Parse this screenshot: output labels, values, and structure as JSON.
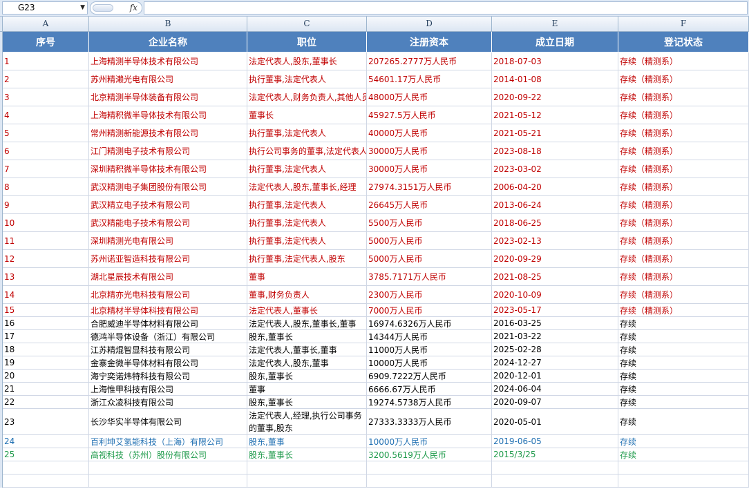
{
  "namebox": {
    "value": "G23"
  },
  "formula_bar": {
    "fx_label": "fx",
    "value": ""
  },
  "columns": [
    "A",
    "B",
    "C",
    "D",
    "E",
    "F"
  ],
  "headers": [
    "序号",
    "企业名称",
    "职位",
    "注册资本",
    "成立日期",
    "登记状态"
  ],
  "rows": [
    {
      "cells": [
        "1",
        "上海精测半导体技术有限公司",
        "法定代表人,股东,董事长",
        "207265.2777万人民币",
        "2018-07-03",
        "存续（精测系）"
      ],
      "color": "#c00000"
    },
    {
      "cells": [
        "2",
        "苏州精濑光电有限公司",
        "执行董事,法定代表人",
        "54601.17万人民币",
        "2014-01-08",
        "存续（精测系）"
      ],
      "color": "#c00000"
    },
    {
      "cells": [
        "3",
        "北京精测半导体装备有限公司",
        "法定代表人,财务负责人,其他人员",
        "48000万人民币",
        "2020-09-22",
        "存续（精测系）"
      ],
      "color": "#c00000"
    },
    {
      "cells": [
        "4",
        "上海精积微半导体技术有限公司",
        "董事长",
        "45927.5万人民币",
        "2021-05-12",
        "存续（精测系）"
      ],
      "color": "#c00000"
    },
    {
      "cells": [
        "5",
        "常州精测新能源技术有限公司",
        "执行董事,法定代表人",
        "40000万人民币",
        "2021-05-21",
        "存续（精测系）"
      ],
      "color": "#c00000"
    },
    {
      "cells": [
        "6",
        "江门精测电子技术有限公司",
        "执行公司事务的董事,法定代表人",
        "30000万人民币",
        "2023-08-18",
        "存续（精测系）"
      ],
      "color": "#c00000"
    },
    {
      "cells": [
        "7",
        "深圳精积微半导体技术有限公司",
        "执行董事,法定代表人",
        "30000万人民币",
        "2023-03-02",
        "存续（精测系）"
      ],
      "color": "#c00000"
    },
    {
      "cells": [
        "8",
        "武汉精测电子集团股份有限公司",
        "法定代表人,股东,董事长,经理",
        "27974.3151万人民币",
        "2006-04-20",
        "存续（精测系）"
      ],
      "color": "#c00000"
    },
    {
      "cells": [
        "9",
        "武汉精立电子技术有限公司",
        "执行董事,法定代表人",
        "26645万人民币",
        "2013-06-24",
        "存续（精测系）"
      ],
      "color": "#c00000"
    },
    {
      "cells": [
        "10",
        "武汉精能电子技术有限公司",
        "执行董事,法定代表人",
        "5500万人民币",
        "2018-06-25",
        "存续（精测系）"
      ],
      "color": "#c00000"
    },
    {
      "cells": [
        "11",
        "深圳精测光电有限公司",
        "执行董事,法定代表人",
        "5000万人民币",
        "2023-02-13",
        "存续（精测系）"
      ],
      "color": "#c00000"
    },
    {
      "cells": [
        "12",
        "苏州诺亚智造科技有限公司",
        "执行董事,法定代表人,股东",
        "5000万人民币",
        "2020-09-29",
        "存续（精测系）"
      ],
      "color": "#c00000"
    },
    {
      "cells": [
        "13",
        "湖北星辰技术有限公司",
        "董事",
        "3785.7171万人民币",
        "2021-08-25",
        "存续（精测系）"
      ],
      "color": "#c00000"
    },
    {
      "cells": [
        "14",
        "北京精亦光电科技有限公司",
        "董事,财务负责人",
        "2300万人民币",
        "2020-10-09",
        "存续（精测系）"
      ],
      "color": "#c00000"
    },
    {
      "cells": [
        "15",
        "北京精材半导体科技有限公司",
        "法定代表人,董事长",
        "7000万人民币",
        "2023-05-17",
        "存续（精测系）"
      ],
      "color": "#c00000"
    },
    {
      "cells": [
        "16",
        "合肥威迪半导体材料有限公司",
        "法定代表人,股东,董事长,董事",
        "16974.6326万人民币",
        "2016-03-25",
        "存续"
      ],
      "color": "#000000"
    },
    {
      "cells": [
        "17",
        "德鸿半导体设备（浙江）有限公司",
        "股东,董事长",
        "14344万人民币",
        "2021-03-22",
        "存续"
      ],
      "color": "#000000"
    },
    {
      "cells": [
        "18",
        "江苏精焜智显科技有限公司",
        "法定代表人,董事长,董事",
        "11000万人民币",
        "2025-02-28",
        "存续"
      ],
      "color": "#000000"
    },
    {
      "cells": [
        "19",
        "金寨金微半导体材料有限公司",
        "法定代表人,股东,董事",
        "10000万人民币",
        "2024-12-27",
        "存续"
      ],
      "color": "#000000"
    },
    {
      "cells": [
        "20",
        "海宁奕诺炜特科技有限公司",
        "股东,董事长",
        "6909.7222万人民币",
        "2020-12-01",
        "存续"
      ],
      "color": "#000000"
    },
    {
      "cells": [
        "21",
        "上海惟甲科技有限公司",
        "董事",
        "6666.67万人民币",
        "2024-06-04",
        "存续"
      ],
      "color": "#000000"
    },
    {
      "cells": [
        "22",
        "浙江众凌科技有限公司",
        "股东,董事长",
        "19274.5738万人民币",
        "2020-09-07",
        "存续"
      ],
      "color": "#000000"
    },
    {
      "cells": [
        "23",
        "长沙华实半导体有限公司",
        "法定代表人,经理,执行公司事务的董事,股东",
        "27333.3333万人民币",
        "2020-05-01",
        "存续"
      ],
      "color": "#000000"
    },
    {
      "cells": [
        "24",
        "百利坤艾氢能科技（上海）有限公司",
        "股东,董事",
        "10000万人民币",
        "2019-06-05",
        "存续"
      ],
      "color": "#1f6fb2"
    },
    {
      "cells": [
        "25",
        "高视科技（苏州）股份有限公司",
        "股东,董事长",
        "3200.5619万人民币",
        "2015/3/25",
        "存续"
      ],
      "color": "#1e9a4a"
    }
  ]
}
